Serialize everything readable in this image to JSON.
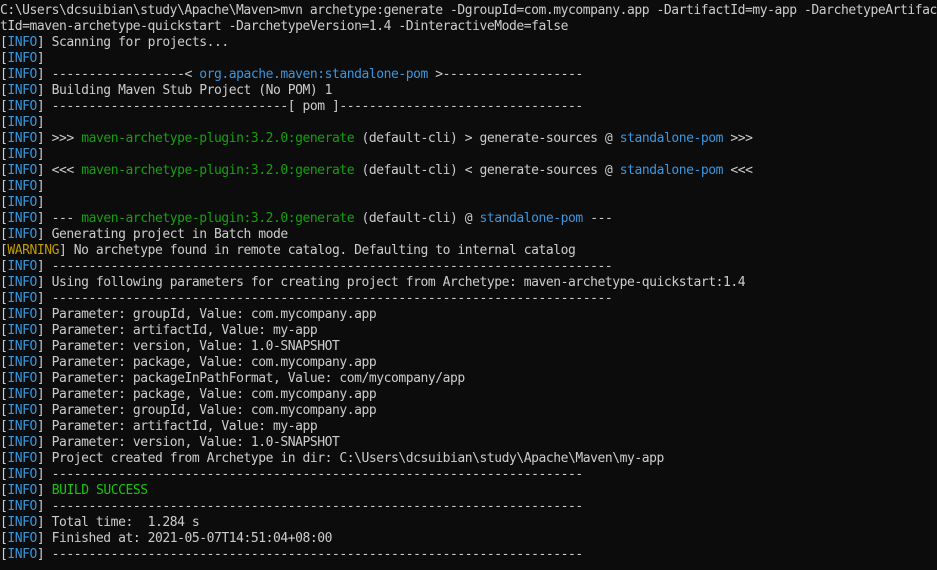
{
  "window": {
    "command": "C:\\Users\\dcsuibian\\study\\Apache\\Maven>mvn archetype:generate -DgroupId=com.mycompany.app -DartifactId=my-app -DarchetypeArtifactId=maven-archetype-quickstart -DarchetypeVersion=1.4 -DinteractiveMode=false"
  },
  "colors": {
    "background": "#0c0c0c",
    "text": "#cccccc",
    "info_tag": "#3a96dd",
    "warning_tag": "#c19c00",
    "highlight_blue": "#3a96dd",
    "highlight_green": "#13a10e",
    "success_green": "#16c60c"
  },
  "lines": [
    {
      "tag": "INFO",
      "segments": [
        {
          "text": " Scanning for projects...",
          "style": "white"
        }
      ]
    },
    {
      "tag": "INFO",
      "segments": []
    },
    {
      "tag": "INFO",
      "segments": [
        {
          "text": " ------------------< ",
          "style": "white"
        },
        {
          "text": "org.apache.maven:standalone-pom",
          "style": "blue"
        },
        {
          "text": " >-------------------",
          "style": "white"
        }
      ]
    },
    {
      "tag": "INFO",
      "segments": [
        {
          "text": " Building Maven Stub Project (No POM) 1",
          "style": "white"
        }
      ]
    },
    {
      "tag": "INFO",
      "segments": [
        {
          "text": " --------------------------------[ pom ]---------------------------------",
          "style": "white"
        }
      ]
    },
    {
      "tag": "INFO",
      "segments": []
    },
    {
      "tag": "INFO",
      "segments": [
        {
          "text": " >>> ",
          "style": "white"
        },
        {
          "text": "maven-archetype-plugin:3.2.0:generate",
          "style": "green"
        },
        {
          "text": " (default-cli) > generate-sources @ ",
          "style": "white"
        },
        {
          "text": "standalone-pom",
          "style": "blue"
        },
        {
          "text": " >>>",
          "style": "white"
        }
      ]
    },
    {
      "tag": "INFO",
      "segments": []
    },
    {
      "tag": "INFO",
      "segments": [
        {
          "text": " <<< ",
          "style": "white"
        },
        {
          "text": "maven-archetype-plugin:3.2.0:generate",
          "style": "green"
        },
        {
          "text": " (default-cli) < generate-sources @ ",
          "style": "white"
        },
        {
          "text": "standalone-pom",
          "style": "blue"
        },
        {
          "text": " <<<",
          "style": "white"
        }
      ]
    },
    {
      "tag": "INFO",
      "segments": []
    },
    {
      "tag": "INFO",
      "segments": []
    },
    {
      "tag": "INFO",
      "segments": [
        {
          "text": " --- ",
          "style": "white"
        },
        {
          "text": "maven-archetype-plugin:3.2.0:generate",
          "style": "green"
        },
        {
          "text": " (default-cli) @ ",
          "style": "white"
        },
        {
          "text": "standalone-pom",
          "style": "blue"
        },
        {
          "text": " ---",
          "style": "white"
        }
      ]
    },
    {
      "tag": "INFO",
      "segments": [
        {
          "text": " Generating project in Batch mode",
          "style": "white"
        }
      ]
    },
    {
      "tag": "WARNING",
      "segments": [
        {
          "text": " No archetype found in remote catalog. Defaulting to internal catalog",
          "style": "white"
        }
      ]
    },
    {
      "tag": "INFO",
      "segments": [
        {
          "text": " ----------------------------------------------------------------------------",
          "style": "white"
        }
      ]
    },
    {
      "tag": "INFO",
      "segments": [
        {
          "text": " Using following parameters for creating project from Archetype: maven-archetype-quickstart:1.4",
          "style": "white"
        }
      ]
    },
    {
      "tag": "INFO",
      "segments": [
        {
          "text": " ----------------------------------------------------------------------------",
          "style": "white"
        }
      ]
    },
    {
      "tag": "INFO",
      "segments": [
        {
          "text": " Parameter: groupId, Value: com.mycompany.app",
          "style": "white"
        }
      ]
    },
    {
      "tag": "INFO",
      "segments": [
        {
          "text": " Parameter: artifactId, Value: my-app",
          "style": "white"
        }
      ]
    },
    {
      "tag": "INFO",
      "segments": [
        {
          "text": " Parameter: version, Value: 1.0-SNAPSHOT",
          "style": "white"
        }
      ]
    },
    {
      "tag": "INFO",
      "segments": [
        {
          "text": " Parameter: package, Value: com.mycompany.app",
          "style": "white"
        }
      ]
    },
    {
      "tag": "INFO",
      "segments": [
        {
          "text": " Parameter: packageInPathFormat, Value: com/mycompany/app",
          "style": "white"
        }
      ]
    },
    {
      "tag": "INFO",
      "segments": [
        {
          "text": " Parameter: package, Value: com.mycompany.app",
          "style": "white"
        }
      ]
    },
    {
      "tag": "INFO",
      "segments": [
        {
          "text": " Parameter: groupId, Value: com.mycompany.app",
          "style": "white"
        }
      ]
    },
    {
      "tag": "INFO",
      "segments": [
        {
          "text": " Parameter: artifactId, Value: my-app",
          "style": "white"
        }
      ]
    },
    {
      "tag": "INFO",
      "segments": [
        {
          "text": " Parameter: version, Value: 1.0-SNAPSHOT",
          "style": "white"
        }
      ]
    },
    {
      "tag": "INFO",
      "segments": [
        {
          "text": " Project created from Archetype in dir: C:\\Users\\dcsuibian\\study\\Apache\\Maven\\my-app",
          "style": "white"
        }
      ]
    },
    {
      "tag": "INFO",
      "segments": [
        {
          "text": " ------------------------------------------------------------------------",
          "style": "white"
        }
      ]
    },
    {
      "tag": "INFO",
      "segments": [
        {
          "text": " ",
          "style": "white"
        },
        {
          "text": "BUILD SUCCESS",
          "style": "success"
        }
      ]
    },
    {
      "tag": "INFO",
      "segments": [
        {
          "text": " ------------------------------------------------------------------------",
          "style": "white"
        }
      ]
    },
    {
      "tag": "INFO",
      "segments": [
        {
          "text": " Total time:  1.284 s",
          "style": "white"
        }
      ]
    },
    {
      "tag": "INFO",
      "segments": [
        {
          "text": " Finished at: 2021-05-07T14:51:04+08:00",
          "style": "white"
        }
      ]
    },
    {
      "tag": "INFO",
      "segments": [
        {
          "text": " ------------------------------------------------------------------------",
          "style": "white"
        }
      ]
    }
  ]
}
